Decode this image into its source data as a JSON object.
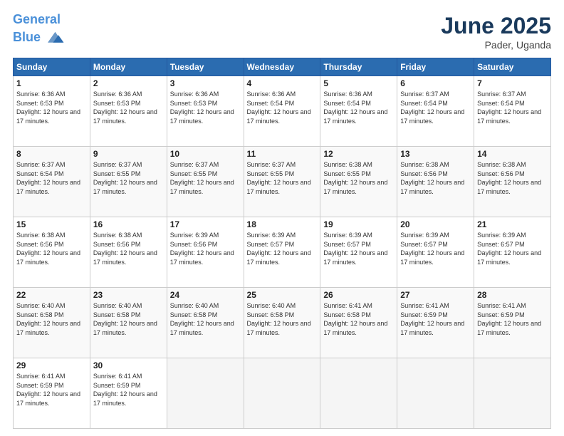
{
  "header": {
    "logo_line1": "General",
    "logo_line2": "Blue",
    "month_title": "June 2025",
    "location": "Pader, Uganda"
  },
  "days_of_week": [
    "Sunday",
    "Monday",
    "Tuesday",
    "Wednesday",
    "Thursday",
    "Friday",
    "Saturday"
  ],
  "weeks": [
    [
      {
        "day": 1,
        "sunrise": "6:36 AM",
        "sunset": "6:53 PM",
        "daylight": "12 hours and 17 minutes."
      },
      {
        "day": 2,
        "sunrise": "6:36 AM",
        "sunset": "6:53 PM",
        "daylight": "12 hours and 17 minutes."
      },
      {
        "day": 3,
        "sunrise": "6:36 AM",
        "sunset": "6:53 PM",
        "daylight": "12 hours and 17 minutes."
      },
      {
        "day": 4,
        "sunrise": "6:36 AM",
        "sunset": "6:54 PM",
        "daylight": "12 hours and 17 minutes."
      },
      {
        "day": 5,
        "sunrise": "6:36 AM",
        "sunset": "6:54 PM",
        "daylight": "12 hours and 17 minutes."
      },
      {
        "day": 6,
        "sunrise": "6:37 AM",
        "sunset": "6:54 PM",
        "daylight": "12 hours and 17 minutes."
      },
      {
        "day": 7,
        "sunrise": "6:37 AM",
        "sunset": "6:54 PM",
        "daylight": "12 hours and 17 minutes."
      }
    ],
    [
      {
        "day": 8,
        "sunrise": "6:37 AM",
        "sunset": "6:54 PM",
        "daylight": "12 hours and 17 minutes."
      },
      {
        "day": 9,
        "sunrise": "6:37 AM",
        "sunset": "6:55 PM",
        "daylight": "12 hours and 17 minutes."
      },
      {
        "day": 10,
        "sunrise": "6:37 AM",
        "sunset": "6:55 PM",
        "daylight": "12 hours and 17 minutes."
      },
      {
        "day": 11,
        "sunrise": "6:37 AM",
        "sunset": "6:55 PM",
        "daylight": "12 hours and 17 minutes."
      },
      {
        "day": 12,
        "sunrise": "6:38 AM",
        "sunset": "6:55 PM",
        "daylight": "12 hours and 17 minutes."
      },
      {
        "day": 13,
        "sunrise": "6:38 AM",
        "sunset": "6:56 PM",
        "daylight": "12 hours and 17 minutes."
      },
      {
        "day": 14,
        "sunrise": "6:38 AM",
        "sunset": "6:56 PM",
        "daylight": "12 hours and 17 minutes."
      }
    ],
    [
      {
        "day": 15,
        "sunrise": "6:38 AM",
        "sunset": "6:56 PM",
        "daylight": "12 hours and 17 minutes."
      },
      {
        "day": 16,
        "sunrise": "6:38 AM",
        "sunset": "6:56 PM",
        "daylight": "12 hours and 17 minutes."
      },
      {
        "day": 17,
        "sunrise": "6:39 AM",
        "sunset": "6:56 PM",
        "daylight": "12 hours and 17 minutes."
      },
      {
        "day": 18,
        "sunrise": "6:39 AM",
        "sunset": "6:57 PM",
        "daylight": "12 hours and 17 minutes."
      },
      {
        "day": 19,
        "sunrise": "6:39 AM",
        "sunset": "6:57 PM",
        "daylight": "12 hours and 17 minutes."
      },
      {
        "day": 20,
        "sunrise": "6:39 AM",
        "sunset": "6:57 PM",
        "daylight": "12 hours and 17 minutes."
      },
      {
        "day": 21,
        "sunrise": "6:39 AM",
        "sunset": "6:57 PM",
        "daylight": "12 hours and 17 minutes."
      }
    ],
    [
      {
        "day": 22,
        "sunrise": "6:40 AM",
        "sunset": "6:58 PM",
        "daylight": "12 hours and 17 minutes."
      },
      {
        "day": 23,
        "sunrise": "6:40 AM",
        "sunset": "6:58 PM",
        "daylight": "12 hours and 17 minutes."
      },
      {
        "day": 24,
        "sunrise": "6:40 AM",
        "sunset": "6:58 PM",
        "daylight": "12 hours and 17 minutes."
      },
      {
        "day": 25,
        "sunrise": "6:40 AM",
        "sunset": "6:58 PM",
        "daylight": "12 hours and 17 minutes."
      },
      {
        "day": 26,
        "sunrise": "6:41 AM",
        "sunset": "6:58 PM",
        "daylight": "12 hours and 17 minutes."
      },
      {
        "day": 27,
        "sunrise": "6:41 AM",
        "sunset": "6:59 PM",
        "daylight": "12 hours and 17 minutes."
      },
      {
        "day": 28,
        "sunrise": "6:41 AM",
        "sunset": "6:59 PM",
        "daylight": "12 hours and 17 minutes."
      }
    ],
    [
      {
        "day": 29,
        "sunrise": "6:41 AM",
        "sunset": "6:59 PM",
        "daylight": "12 hours and 17 minutes."
      },
      {
        "day": 30,
        "sunrise": "6:41 AM",
        "sunset": "6:59 PM",
        "daylight": "12 hours and 17 minutes."
      },
      null,
      null,
      null,
      null,
      null
    ]
  ]
}
